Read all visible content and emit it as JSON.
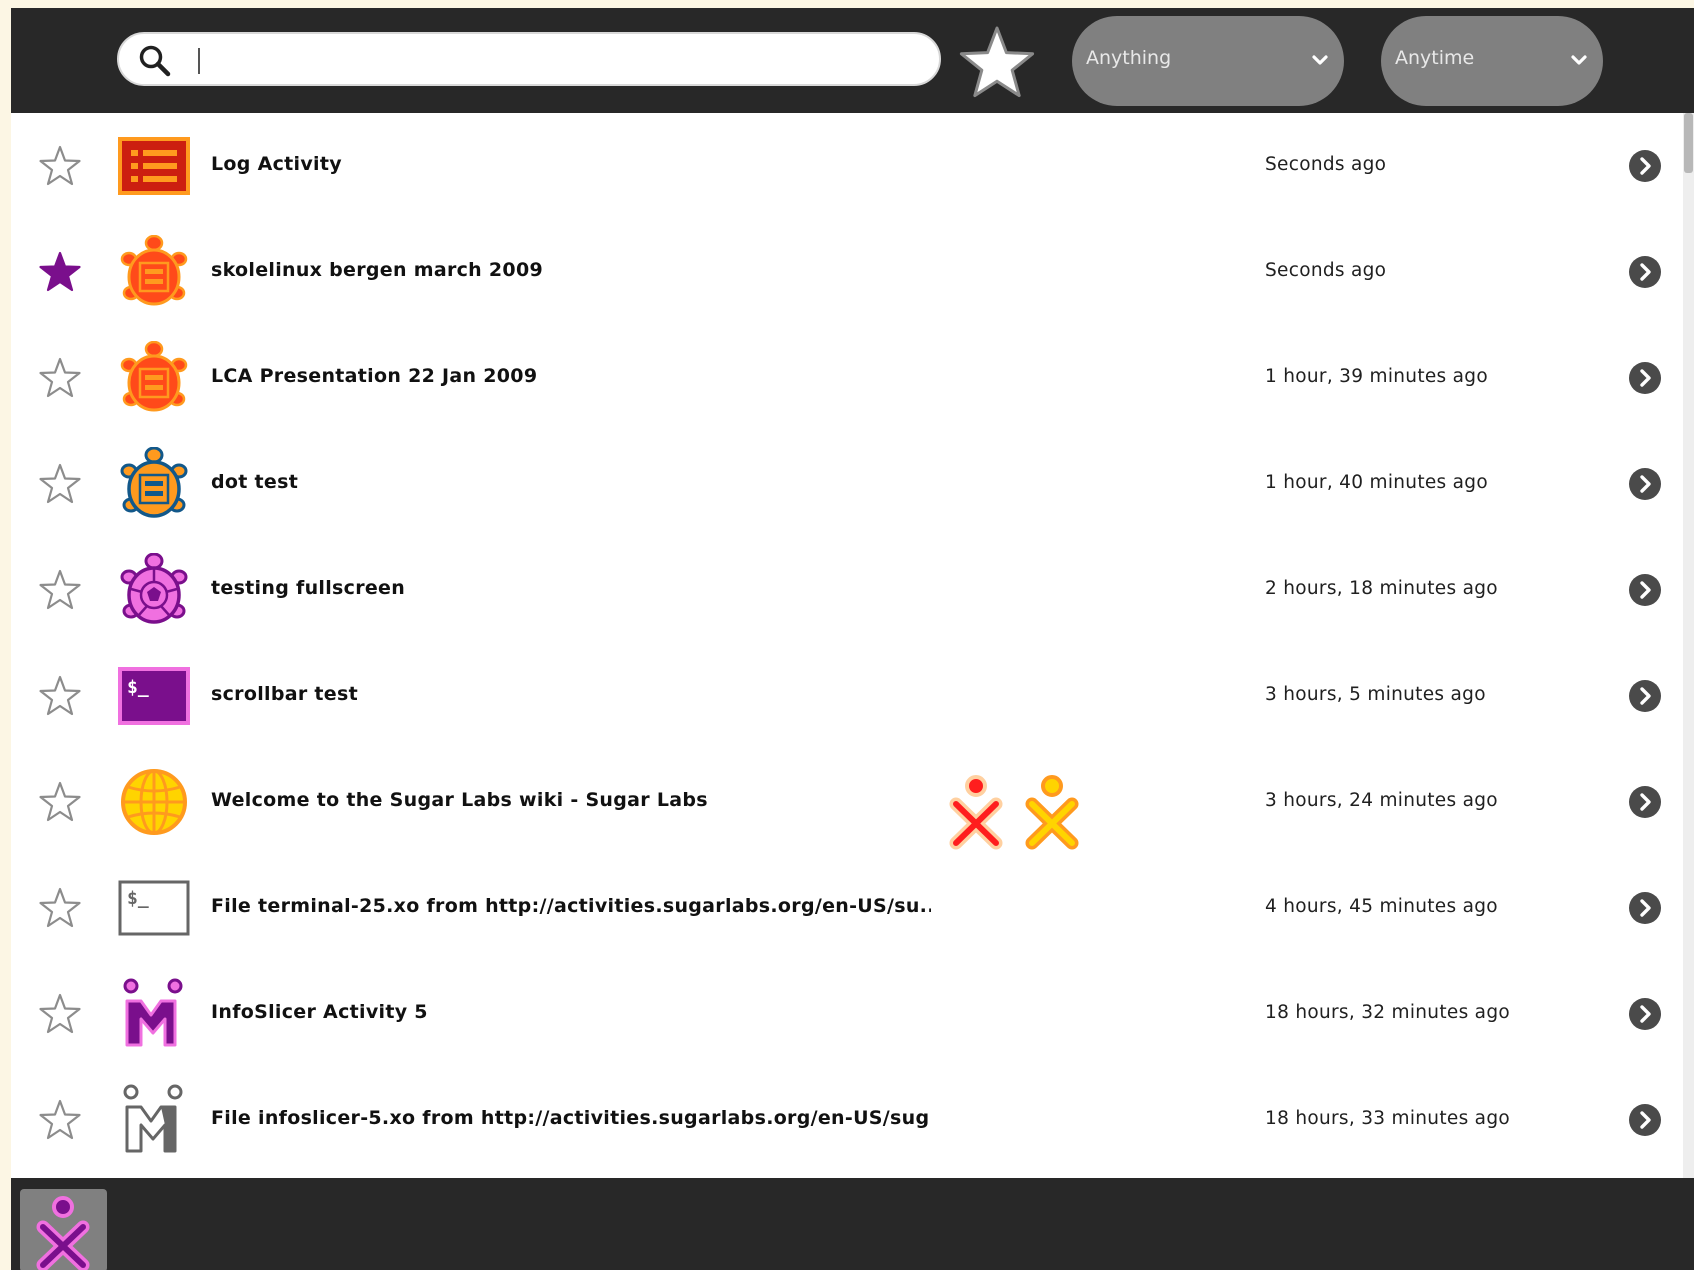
{
  "search": {
    "value": "",
    "placeholder": ""
  },
  "filters": {
    "type_label": "Anything",
    "time_label": "Anytime"
  },
  "entries": [
    {
      "title": "Log Activity",
      "time": "Seconds ago",
      "favorite": false,
      "icon": "log-activity-icon"
    },
    {
      "title": "skolelinux bergen march 2009",
      "time": "Seconds ago",
      "favorite": true,
      "icon": "turtle-art-icon"
    },
    {
      "title": "LCA Presentation 22 Jan 2009",
      "time": "1 hour, 39 minutes ago",
      "favorite": false,
      "icon": "turtle-art-icon"
    },
    {
      "title": "dot test",
      "time": "1 hour, 40 minutes ago",
      "favorite": false,
      "icon": "turtle-art-icon"
    },
    {
      "title": "testing fullscreen",
      "time": "2 hours, 18 minutes ago",
      "favorite": false,
      "icon": "turtle-icon"
    },
    {
      "title": "scrollbar test",
      "time": "3 hours, 5 minutes ago",
      "favorite": false,
      "icon": "terminal-icon"
    },
    {
      "title": "Welcome to the Sugar Labs wiki - Sugar Labs",
      "time": "3 hours, 24 minutes ago",
      "favorite": false,
      "icon": "browse-globe-icon"
    },
    {
      "title": "File terminal-25.xo from http://activities.sugarlabs.org/en-US/su...",
      "time": "4 hours, 45 minutes ago",
      "favorite": false,
      "icon": "terminal-bundle-icon"
    },
    {
      "title": "InfoSlicer Activity 5",
      "time": "18 hours, 32 minutes ago",
      "favorite": false,
      "icon": "infoslicer-icon"
    },
    {
      "title": "File infoslicer-5.xo from http://activities.sugarlabs.org/en-US/sug...",
      "time": "18 hours, 33 minutes ago",
      "favorite": false,
      "icon": "infoslicer-bundle-icon"
    }
  ],
  "colors": {
    "toolbar_bg": "#282828",
    "favorite_star": "#7a0f8c",
    "combo_bg": "#808080"
  }
}
